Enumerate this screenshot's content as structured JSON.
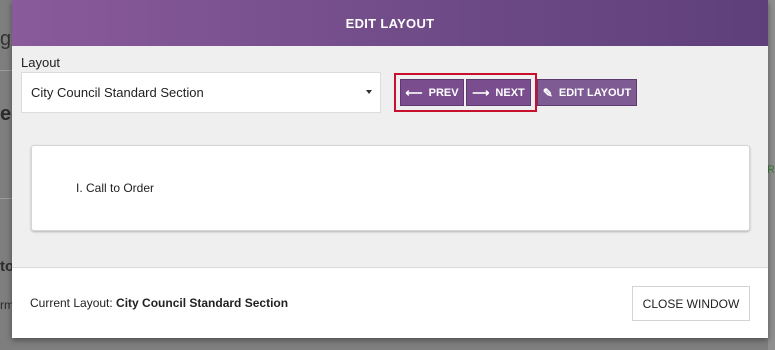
{
  "background": {
    "frag1": "ge",
    "frag2": "eg",
    "frag3": "to",
    "frag4": "rm",
    "right_frag": "R"
  },
  "modal": {
    "title": "EDIT LAYOUT",
    "layout_label": "Layout",
    "layout_select": {
      "value": "City Council Standard Section"
    },
    "buttons": {
      "prev": "PREV",
      "next": "NEXT",
      "edit_layout": "EDIT LAYOUT"
    },
    "content_items": [
      "I. Call to Order"
    ],
    "footer": {
      "current_layout_label": "Current Layout:",
      "current_layout_value": "City Council Standard Section",
      "close_button": "CLOSE WINDOW"
    }
  },
  "colors": {
    "header_purple": "#7a4e8e",
    "highlight_red": "#c8102e"
  }
}
